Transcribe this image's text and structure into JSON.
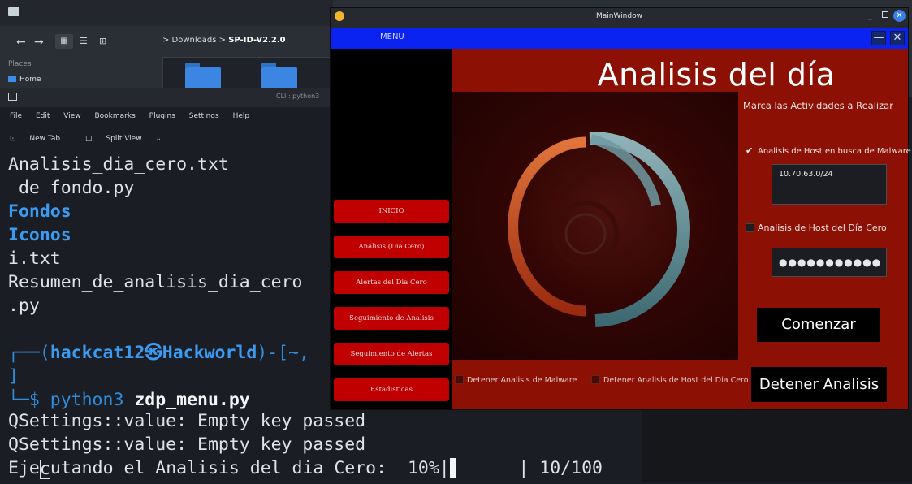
{
  "file_manager": {
    "breadcrumb_parent": "> Downloads >",
    "breadcrumb_current": "SP-ID-V2.2.0",
    "places_label": "Places",
    "home_label": "Home"
  },
  "terminal": {
    "title": "CLI : python3",
    "menu": [
      "File",
      "Edit",
      "View",
      "Bookmarks",
      "Plugins",
      "Settings",
      "Help"
    ],
    "tabs": [
      "New Tab",
      "Split View"
    ],
    "lines": {
      "l1": "Analisis_dia_cero.txt",
      "l2": "_de_fondo.py",
      "l3": "Fondos",
      "l4": "Iconos",
      "l5": "i.txt",
      "l6": "Resumen_de_analisis_dia_cero",
      "l7": ".py",
      "prompt_open": "┌──(",
      "prompt_user": "hackcat12",
      "prompt_at": "㉿",
      "prompt_host": "Hackworld",
      "prompt_close": ")-[~,",
      "prompt_bracket": "]",
      "cmd_prefix": "└─$ ",
      "cmd_python": "python3 ",
      "cmd_script": "zdp_menu.py",
      "q1": "QSettings::value: Empty key passed",
      "q2": "QSettings::value: Empty key passed",
      "exec_a": "Eje",
      "exec_cursor": "c",
      "exec_b": "utando el Analisis del dia Cero:  10%|",
      "exec_c": "      | 10/100"
    }
  },
  "main_window": {
    "title": "MainWindow",
    "menu_label": "MENU",
    "minimize_glyph": "—",
    "close_glyph": "✕",
    "heading": "Analisis del día",
    "sidebar": [
      "INICIO",
      "Analisis (Dia Cero)",
      "Alertas del Dia Cero",
      "Seguimiento de Analisis",
      "Seguimiento de Alertas",
      "Estadisticas"
    ],
    "options_title": "Marca las Actividades a Realizar",
    "option_malware": "Analisis de Host en busca de Malware",
    "option_malware_checked": true,
    "ip_value": "10.70.63.0/24",
    "option_zero_day": "Analisis de Host del Día Cero",
    "option_zero_day_checked": false,
    "password_dots": "●●●●●●●●●●●",
    "start_button": "Comenzar",
    "stop_button": "Detener Analisis",
    "stop_malware": "Detener Analisis de Malware",
    "stop_zero_day": "Detener Analisis de Host del Dia Cero"
  },
  "colors": {
    "menu_bar": "#0a23f0",
    "content_bg": "#8d1005",
    "sidebar_button": "#c00000",
    "terminal_blue": "#3b9bf3"
  }
}
